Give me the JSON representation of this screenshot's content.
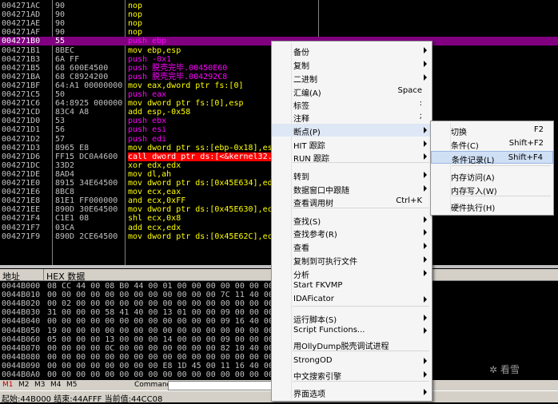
{
  "disasm": {
    "rows": [
      {
        "addr": "004271AC",
        "hex": "90",
        "asm": "nop",
        "kind": "nop"
      },
      {
        "addr": "004271AD",
        "hex": "90",
        "asm": "nop",
        "kind": "nop"
      },
      {
        "addr": "004271AE",
        "hex": "90",
        "asm": "nop",
        "kind": "nop"
      },
      {
        "addr": "004271AF",
        "hex": "90",
        "asm": "nop",
        "kind": "nop"
      },
      {
        "addr": "004271B0",
        "hex": "55",
        "asm": "push ebp",
        "kind": "push",
        "selected": true
      },
      {
        "addr": "004271B1",
        "hex": "8BEC",
        "asm": "mov ebp,esp",
        "kind": "mov"
      },
      {
        "addr": "004271B3",
        "hex": "6A FF",
        "asm": "push -0x1",
        "kind": "push"
      },
      {
        "addr": "004271B5",
        "hex": "68 600E4500",
        "asm": "push 脱壳完毕.00450E60",
        "kind": "push"
      },
      {
        "addr": "004271BA",
        "hex": "68 C8924200",
        "asm": "push 脱壳完毕.004292C8",
        "kind": "push"
      },
      {
        "addr": "004271BF",
        "hex": "64:A1 00000000",
        "asm": "mov eax,dword ptr fs:[0]",
        "kind": "mov"
      },
      {
        "addr": "004271C5",
        "hex": "50",
        "asm": "push eax",
        "kind": "push"
      },
      {
        "addr": "004271C6",
        "hex": "64:8925 000000",
        "asm": "mov dword ptr fs:[0],esp",
        "kind": "mov"
      },
      {
        "addr": "004271CD",
        "hex": "83C4 A8",
        "asm": "add esp,-0x58",
        "kind": "add"
      },
      {
        "addr": "004271D0",
        "hex": "53",
        "asm": "push ebx",
        "kind": "push"
      },
      {
        "addr": "004271D1",
        "hex": "56",
        "asm": "push esi",
        "kind": "push"
      },
      {
        "addr": "004271D2",
        "hex": "57",
        "asm": "push edi",
        "kind": "push"
      },
      {
        "addr": "004271D3",
        "hex": "8965 E8",
        "asm": "mov dword ptr ss:[ebp-0x18],esp",
        "kind": "mov"
      },
      {
        "addr": "004271D6",
        "hex": "FF15 DC0A4600",
        "asm": "call dword ptr ds:[<&kernel32.",
        "kind": "call"
      },
      {
        "addr": "004271DC",
        "hex": "33D2",
        "asm": "xor edx,edx",
        "kind": "xor"
      },
      {
        "addr": "004271DE",
        "hex": "8AD4",
        "asm": "mov dl,ah",
        "kind": "mov"
      },
      {
        "addr": "004271E0",
        "hex": "8915 34E64500",
        "asm": "mov dword ptr ds:[0x45E634],ed",
        "kind": "mov"
      },
      {
        "addr": "004271E6",
        "hex": "8BC8",
        "asm": "mov ecx,eax",
        "kind": "mov"
      },
      {
        "addr": "004271E8",
        "hex": "81E1 FF000000",
        "asm": "and ecx,0xFF",
        "kind": "mov"
      },
      {
        "addr": "004271EE",
        "hex": "890D 30E64500",
        "asm": "mov dword ptr ds:[0x45E630],ec",
        "kind": "mov"
      },
      {
        "addr": "004271F4",
        "hex": "C1E1 08",
        "asm": "shl ecx,0x8",
        "kind": "shl"
      },
      {
        "addr": "004271F7",
        "hex": "03CA",
        "asm": "add ecx,edx",
        "kind": "add"
      },
      {
        "addr": "004271F9",
        "hex": "890D 2CE64500",
        "asm": "mov dword ptr ds:[0x45E62C],ec",
        "kind": "mov"
      }
    ]
  },
  "hex": {
    "header_addr": "地址",
    "header_data": "HEX 数据",
    "rows": [
      {
        "addr": "0044B000",
        "data": "08 CC 44 00 08 B0 44 00 01 00 00 00 00 00 00 00"
      },
      {
        "addr": "0044B010",
        "data": "00 00 00 00 00 00 00 00 00 00 00 00 7C 11 40 00"
      },
      {
        "addr": "0044B020",
        "data": "00 02 00 00 00 00 00 00 00 00 00 00 00 00 00 00"
      },
      {
        "addr": "0044B030",
        "data": "31 00 00 00 58 41 40 00 13 01 00 00 09 00 00 00"
      },
      {
        "addr": "0044B040",
        "data": "00 00 00 00 00 00 00 00 00 00 00 00 09 16 40 00"
      },
      {
        "addr": "0044B050",
        "data": "19 00 00 00 00 00 00 00 00 00 00 00 00 00 00 00"
      },
      {
        "addr": "0044B060",
        "data": "05 00 00 00 13 00 00 00 14 00 00 00 09 00 00 00"
      },
      {
        "addr": "0044B070",
        "data": "00 00 00 00 0C 00 00 00 00 00 00 00 82 10 40 00"
      },
      {
        "addr": "0044B080",
        "data": "00 00 00 00 00 00 00 00 00 00 00 00 00 00 00 00"
      },
      {
        "addr": "0044B090",
        "data": "00 00 00 00 00 00 00 00 E8 1D 45 00 11 16 40 00"
      },
      {
        "addr": "0044B0A0",
        "data": "00 00 00 00 00 00 00 00 00 00 00 00 00 00 00 00"
      }
    ]
  },
  "cmdbar": {
    "tabs": [
      "M1",
      "M2",
      "M3",
      "M4",
      "M5"
    ],
    "command_label": "Command:",
    "command_value": ""
  },
  "status": {
    "text": "起始:44B000 结束:44AFFF 当前值:44CC08"
  },
  "watermark": "看雪",
  "context_menu": {
    "items": [
      {
        "label": "备份",
        "arrow": true
      },
      {
        "label": "复制",
        "arrow": true
      },
      {
        "label": "二进制",
        "arrow": true
      },
      {
        "label": "汇编(A)",
        "shortcut": "Space"
      },
      {
        "label": "标签",
        "shortcut": ":"
      },
      {
        "label": "注释",
        "shortcut": ";"
      },
      {
        "label": "断点(P)",
        "arrow": true,
        "highlighted": true
      },
      {
        "label": "HIT 跟踪",
        "arrow": true
      },
      {
        "label": "RUN 跟踪",
        "arrow": true
      },
      {
        "label": "转到",
        "arrow": true
      },
      {
        "label": "数据窗口中跟随",
        "arrow": true
      },
      {
        "label": "查看调用树",
        "shortcut": "Ctrl+K"
      },
      {
        "label": "查找(S)",
        "arrow": true
      },
      {
        "label": "查找参考(R)",
        "arrow": true
      },
      {
        "label": "查看",
        "arrow": true
      },
      {
        "label": "复制到可执行文件",
        "arrow": true
      },
      {
        "label": "分析",
        "arrow": true
      },
      {
        "label": "Start FKVMP"
      },
      {
        "label": "IDAFicator",
        "arrow": true
      },
      {
        "label": "运行脚本(S)",
        "arrow": true
      },
      {
        "label": "Script Functions...",
        "arrow": true
      },
      {
        "label": "用OllyDump脱壳调试进程"
      },
      {
        "label": "StrongOD",
        "arrow": true
      },
      {
        "label": "中文搜索引擎",
        "arrow": true
      },
      {
        "label": "界面选项",
        "arrow": true
      }
    ]
  },
  "breakpoint_submenu": {
    "items": [
      {
        "label": "切换",
        "shortcut": "F2"
      },
      {
        "label": "条件(C)",
        "shortcut": "Shift+F2"
      },
      {
        "label": "条件记录(L)",
        "shortcut": "Shift+F4",
        "highlighted": true
      },
      {
        "label": "内存访问(A)"
      },
      {
        "label": "内存写入(W)"
      },
      {
        "label": "硬件执行(H)"
      }
    ]
  }
}
